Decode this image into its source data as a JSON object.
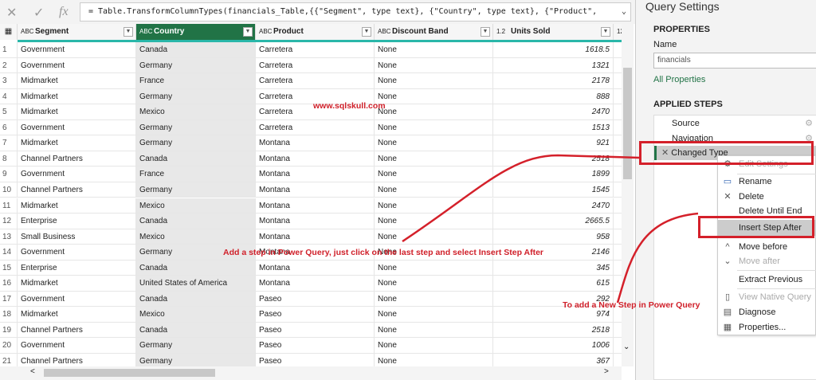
{
  "formula_bar": {
    "cancel": "✕",
    "commit": "✓",
    "fx": "fx",
    "formula": "= Table.TransformColumnTypes(financials_Table,{{\"Segment\", type text}, {\"Country\", type text}, {\"Product\",",
    "expand": "⌄"
  },
  "columns": [
    {
      "type": "ABC",
      "label": "Segment"
    },
    {
      "type": "ABC",
      "label": "Country"
    },
    {
      "type": "ABC",
      "label": "Product"
    },
    {
      "type": "ABC",
      "label": "Discount Band"
    },
    {
      "type": "1.2",
      "label": "Units Sold"
    },
    {
      "type": "123",
      "label": ""
    }
  ],
  "rows": [
    [
      "1",
      "Government",
      "Canada",
      "Carretera",
      "None",
      "1618.5"
    ],
    [
      "2",
      "Government",
      "Germany",
      "Carretera",
      "None",
      "1321"
    ],
    [
      "3",
      "Midmarket",
      "France",
      "Carretera",
      "None",
      "2178"
    ],
    [
      "4",
      "Midmarket",
      "Germany",
      "Carretera",
      "None",
      "888"
    ],
    [
      "5",
      "Midmarket",
      "Mexico",
      "Carretera",
      "None",
      "2470"
    ],
    [
      "6",
      "Government",
      "Germany",
      "Carretera",
      "None",
      "1513"
    ],
    [
      "7",
      "Midmarket",
      "Germany",
      "Montana",
      "None",
      "921"
    ],
    [
      "8",
      "Channel Partners",
      "Canada",
      "Montana",
      "None",
      "2518"
    ],
    [
      "9",
      "Government",
      "France",
      "Montana",
      "None",
      "1899"
    ],
    [
      "10",
      "Channel Partners",
      "Germany",
      "Montana",
      "None",
      "1545"
    ],
    [
      "11",
      "Midmarket",
      "Mexico",
      "Montana",
      "None",
      "2470"
    ],
    [
      "12",
      "Enterprise",
      "Canada",
      "Montana",
      "None",
      "2665.5"
    ],
    [
      "13",
      "Small Business",
      "Mexico",
      "Montana",
      "None",
      "958"
    ],
    [
      "14",
      "Government",
      "Germany",
      "Montana",
      "None",
      "2146"
    ],
    [
      "15",
      "Enterprise",
      "Canada",
      "Montana",
      "None",
      "345"
    ],
    [
      "16",
      "Midmarket",
      "United States of America",
      "Montana",
      "None",
      "615"
    ],
    [
      "17",
      "Government",
      "Canada",
      "Paseo",
      "None",
      "292"
    ],
    [
      "18",
      "Midmarket",
      "Mexico",
      "Paseo",
      "None",
      "974"
    ],
    [
      "19",
      "Channel Partners",
      "Canada",
      "Paseo",
      "None",
      "2518"
    ],
    [
      "20",
      "Government",
      "Germany",
      "Paseo",
      "None",
      "1006"
    ],
    [
      "21",
      "Channel Partners",
      "Germany",
      "Paseo",
      "None",
      "367"
    ]
  ],
  "query_settings": {
    "title": "Query Settings",
    "properties_heading": "PROPERTIES",
    "name_label": "Name",
    "name_value": "financials",
    "all_properties": "All Properties",
    "applied_steps_heading": "APPLIED STEPS",
    "steps": [
      "Source",
      "Navigation",
      "Changed Type"
    ]
  },
  "context_menu": [
    "Edit Settings",
    "Rename",
    "Delete",
    "Delete Until End",
    "Insert Step After",
    "Move before",
    "Move after",
    "Extract Previous",
    "View Native Query",
    "Diagnose",
    "Properties..."
  ],
  "annotations": {
    "watermark": "www.sqlskull.com",
    "instruction": "Add a step in Power Query, just click on the last step and select Insert Step After",
    "caption": "To add a New Step in Power Query"
  },
  "colors": {
    "accent": "#217346",
    "annotation": "#d4202a",
    "teal": "#2ab7a9"
  }
}
